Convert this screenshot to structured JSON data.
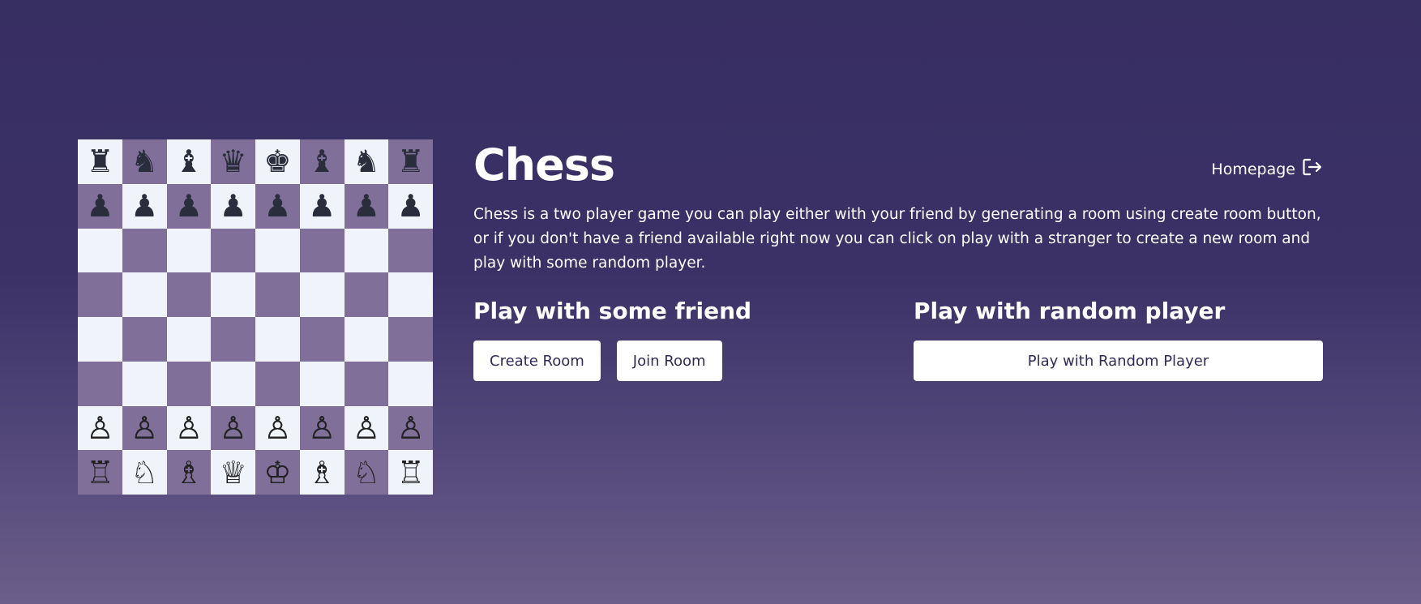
{
  "board": {
    "ranks": [
      [
        "♜",
        "♞",
        "♝",
        "♛",
        "♚",
        "♝",
        "♞",
        "♜"
      ],
      [
        "♟",
        "♟",
        "♟",
        "♟",
        "♟",
        "♟",
        "♟",
        "♟"
      ],
      [
        "",
        "",
        "",
        "",
        "",
        "",
        "",
        ""
      ],
      [
        "",
        "",
        "",
        "",
        "",
        "",
        "",
        ""
      ],
      [
        "",
        "",
        "",
        "",
        "",
        "",
        "",
        ""
      ],
      [
        "",
        "",
        "",
        "",
        "",
        "",
        "",
        ""
      ],
      [
        "♙",
        "♙",
        "♙",
        "♙",
        "♙",
        "♙",
        "♙",
        "♙"
      ],
      [
        "♖",
        "♘",
        "♗",
        "♕",
        "♔",
        "♗",
        "♘",
        "♖"
      ]
    ],
    "colors": {
      "light": "#f0f3f9",
      "dark": "#7f6f99"
    }
  },
  "header": {
    "title": "Chess",
    "homepage_label": "Homepage",
    "homepage_icon": "logout-icon"
  },
  "description": "Chess is a two player game you can play either with your friend by generating a room using create room button, or if you don't have a friend available right now you can click on play with a stranger to create a new room and play with some random player.",
  "friend": {
    "heading": "Play with some friend",
    "create_label": "Create Room",
    "join_label": "Join Room"
  },
  "random": {
    "heading": "Play with random player",
    "play_label": "Play with Random Player"
  },
  "colors": {
    "background_top": "#372e62",
    "background_bottom": "#6b5e8a",
    "button_text": "#2f2a57"
  }
}
